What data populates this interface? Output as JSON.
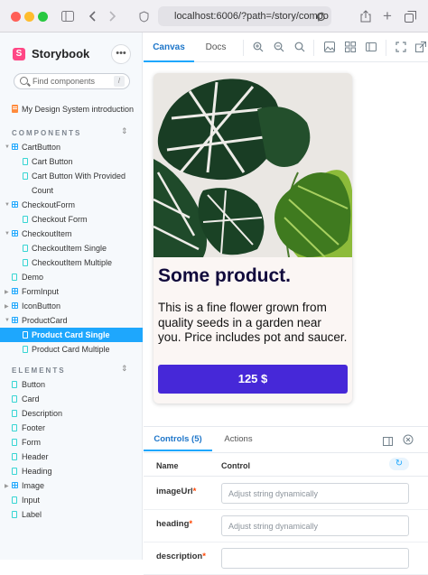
{
  "browser": {
    "url": "localhost:6006/?path=/story/compo",
    "colors": {
      "close": "#ff5f57",
      "minimize": "#febc2e",
      "maximize": "#28c840"
    }
  },
  "sidebar": {
    "brand": "Storybook",
    "brand_mark": "S",
    "menu_label": "•••",
    "search_placeholder": "Find components",
    "search_shortcut": "/",
    "intro": "My Design System introduction",
    "components_header": "COMPONENTS",
    "elements_header": "ELEMENTS",
    "components": [
      {
        "label": "CartButton",
        "kind": "group"
      },
      {
        "label": "Cart Button",
        "kind": "story"
      },
      {
        "label": "Cart Button With Provided",
        "kind": "story"
      },
      {
        "label": "Count",
        "kind": "cont"
      },
      {
        "label": "CheckoutForm",
        "kind": "group"
      },
      {
        "label": "Checkout Form",
        "kind": "story"
      },
      {
        "label": "CheckoutItem",
        "kind": "group"
      },
      {
        "label": "CheckoutItem Single",
        "kind": "story"
      },
      {
        "label": "CheckoutItem Multiple",
        "kind": "story"
      },
      {
        "label": "Demo",
        "kind": "leaf"
      },
      {
        "label": "FormInput",
        "kind": "group-c"
      },
      {
        "label": "IconButton",
        "kind": "group-c"
      },
      {
        "label": "ProductCard",
        "kind": "group"
      },
      {
        "label": "Product Card Single",
        "kind": "story",
        "selected": true
      },
      {
        "label": "Product Card Multiple",
        "kind": "story"
      }
    ],
    "elements": [
      {
        "label": "Button",
        "kind": "leaf"
      },
      {
        "label": "Card",
        "kind": "leaf"
      },
      {
        "label": "Description",
        "kind": "leaf"
      },
      {
        "label": "Footer",
        "kind": "leaf"
      },
      {
        "label": "Form",
        "kind": "leaf"
      },
      {
        "label": "Header",
        "kind": "leaf"
      },
      {
        "label": "Heading",
        "kind": "leaf"
      },
      {
        "label": "Image",
        "kind": "group-c"
      },
      {
        "label": "Input",
        "kind": "leaf"
      },
      {
        "label": "Label",
        "kind": "leaf"
      }
    ]
  },
  "toolbar": {
    "tab_canvas": "Canvas",
    "tab_docs": "Docs"
  },
  "card": {
    "title": "Some product.",
    "description": "This is a fine flower grown from quality seeds in a garden near you. Price includes pot and saucer.",
    "price": "125 $",
    "button_color": "#4628d8"
  },
  "addons": {
    "tab_controls": "Controls (5)",
    "tab_actions": "Actions",
    "col_name": "Name",
    "col_control": "Control",
    "rows": [
      {
        "name": "imageUrl",
        "required": "*",
        "placeholder": "Adjust string dynamically"
      },
      {
        "name": "heading",
        "required": "*",
        "placeholder": "Adjust string dynamically"
      },
      {
        "name": "description",
        "required": "*",
        "placeholder": ""
      }
    ]
  }
}
